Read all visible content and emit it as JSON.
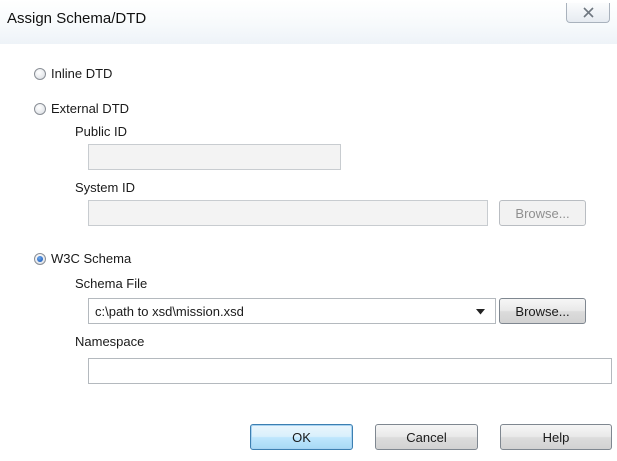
{
  "window": {
    "title": "Assign Schema/DTD",
    "close_icon": "close-icon"
  },
  "options": {
    "inline_dtd": {
      "label": "Inline DTD",
      "selected": false
    },
    "external_dtd": {
      "label": "External DTD",
      "selected": false,
      "public_id_label": "Public ID",
      "public_id_value": "",
      "system_id_label": "System ID",
      "system_id_value": "",
      "browse_label": "Browse..."
    },
    "w3c_schema": {
      "label": "W3C Schema",
      "selected": true,
      "schema_file_label": "Schema File",
      "schema_file_value": "c:\\path to xsd\\mission.xsd",
      "browse_label": "Browse...",
      "namespace_label": "Namespace",
      "namespace_value": ""
    }
  },
  "footer": {
    "ok_label": "OK",
    "cancel_label": "Cancel",
    "help_label": "Help"
  },
  "colors": {
    "default_button_border": "#3c7fb1",
    "radio_selected": "#1f5fbf"
  }
}
